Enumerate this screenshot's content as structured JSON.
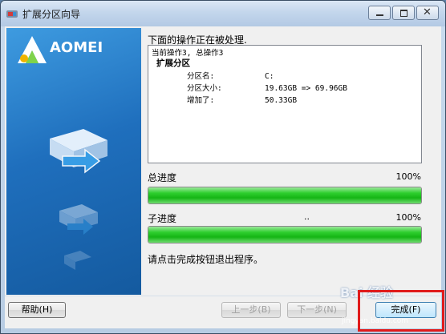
{
  "window": {
    "title": "扩展分区向导"
  },
  "brand": {
    "name": "AOMEI"
  },
  "main": {
    "heading": "下面的操作正在被处理.",
    "log": {
      "line0": "当前操作3, 总操作3",
      "line1": "扩展分区",
      "rows": [
        {
          "label": "分区名:",
          "value": "C:"
        },
        {
          "label": "分区大小:",
          "value": "19.63GB => 69.96GB"
        },
        {
          "label": "增加了:",
          "value": "50.33GB"
        }
      ]
    },
    "total": {
      "label": "总进度",
      "percent_text": "100%",
      "value": 1.0
    },
    "sub": {
      "label": "子进度",
      "dots": "..",
      "percent_text": "100%",
      "value": 1.0
    },
    "note": "请点击完成按钮退出程序。"
  },
  "buttons": {
    "help": "帮助(H)",
    "back": "上一步(B)",
    "next": "下一步(N)",
    "finish": "完成(F)"
  },
  "watermark": {
    "text": "Bai 经验",
    "sub": "jingyan.baidu.com"
  },
  "colors": {
    "progress": "#1db81d",
    "highlight": "#e01b1b"
  }
}
